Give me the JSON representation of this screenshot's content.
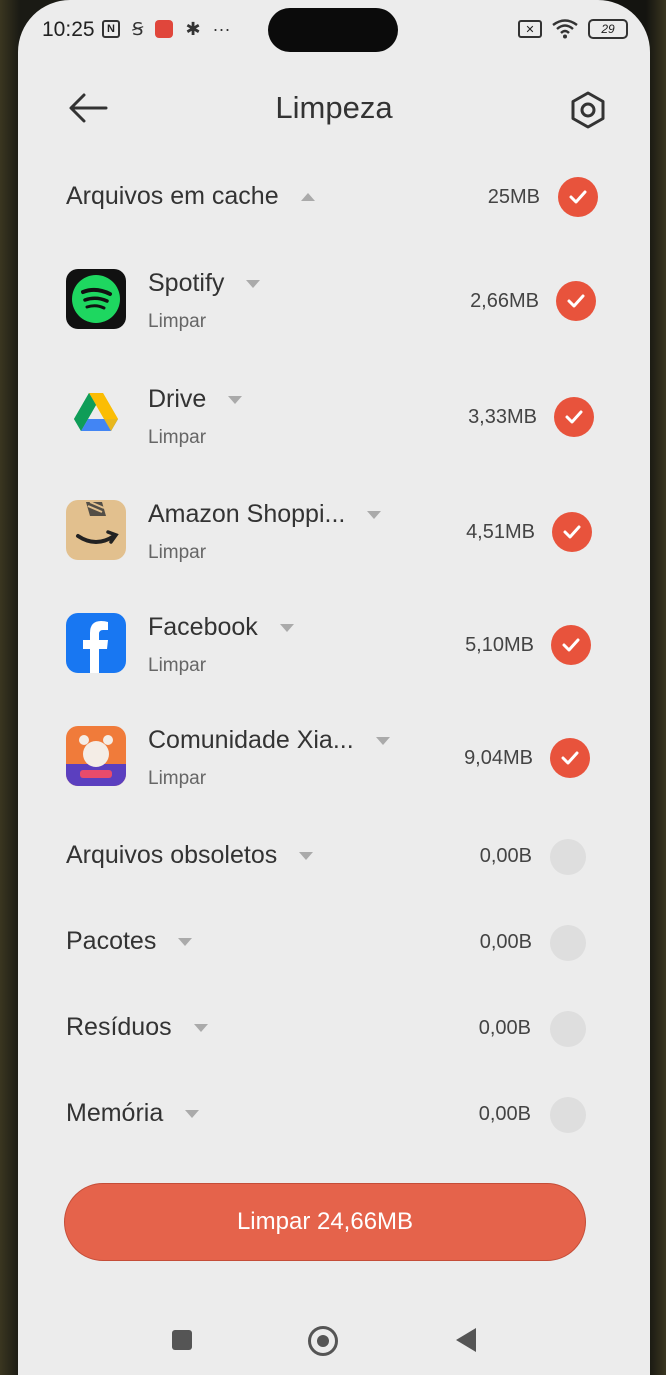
{
  "status_bar": {
    "time": "10:25",
    "battery": "29",
    "icons": [
      "nfc-icon",
      "s-icon",
      "notification-icon",
      "gear-icon",
      "more-dots-icon",
      "sim-off-icon",
      "wifi-icon",
      "battery-icon"
    ]
  },
  "header": {
    "title": "Limpeza",
    "back_icon": "arrow-left-icon",
    "settings_icon": "gear-icon"
  },
  "cache": {
    "label": "Arquivos em cache",
    "size": "25MB",
    "checked": true
  },
  "apps": [
    {
      "name": "Spotify",
      "action": "Limpar",
      "size": "2,66MB",
      "icon": "spotify-icon",
      "checked": true
    },
    {
      "name": "Drive",
      "action": "Limpar",
      "size": "3,33MB",
      "icon": "drive-icon",
      "checked": true
    },
    {
      "name": "Amazon Shoppi...",
      "action": "Limpar",
      "size": "4,51MB",
      "icon": "amazon-icon",
      "checked": true
    },
    {
      "name": "Facebook",
      "action": "Limpar",
      "size": "5,10MB",
      "icon": "facebook-icon",
      "checked": true
    },
    {
      "name": "Comunidade Xia...",
      "action": "Limpar",
      "size": "9,04MB",
      "icon": "xiaomi-community-icon",
      "checked": true
    }
  ],
  "sections": [
    {
      "label": "Arquivos obsoletos",
      "size": "0,00B",
      "checked": false
    },
    {
      "label": "Pacotes",
      "size": "0,00B",
      "checked": false
    },
    {
      "label": "Resíduos",
      "size": "0,00B",
      "checked": false
    },
    {
      "label": "Memória",
      "size": "0,00B",
      "checked": false
    }
  ],
  "clean_button": {
    "label": "Limpar 24,66MB"
  },
  "colors": {
    "accent": "#e8533c",
    "button": "#e5634b",
    "background": "#ececec"
  }
}
